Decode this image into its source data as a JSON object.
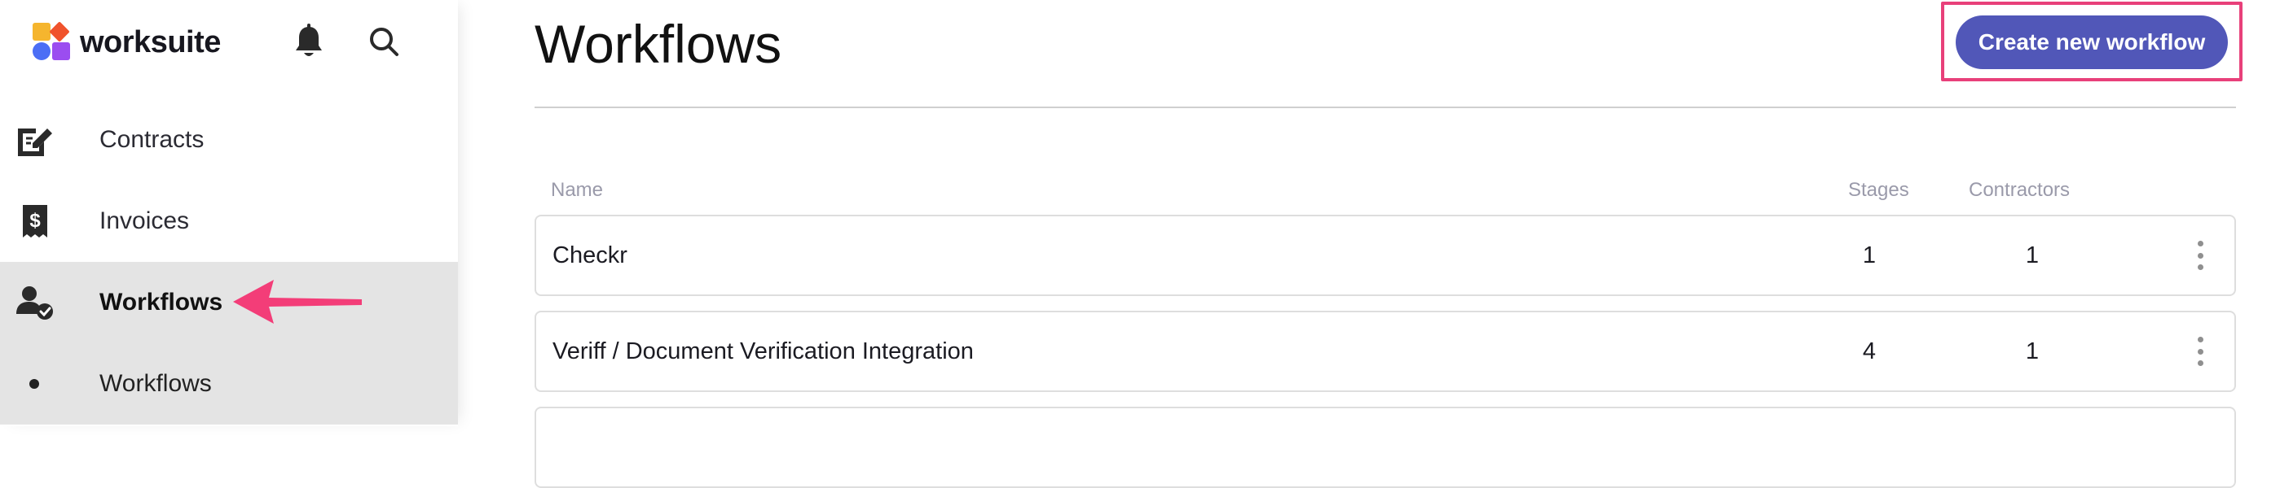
{
  "app": {
    "name": "worksuite"
  },
  "header": {
    "notifications_icon": "bell-icon",
    "search_icon": "search-icon"
  },
  "sidebar": {
    "items": [
      {
        "label": "Contracts",
        "icon": "contract-edit-icon",
        "active": false
      },
      {
        "label": "Invoices",
        "icon": "invoice-dollar-icon",
        "active": false
      },
      {
        "label": "Workflows",
        "icon": "user-check-icon",
        "active": true
      },
      {
        "label": "Workflows",
        "icon": "bullet-dot",
        "active": false,
        "sub": true
      }
    ]
  },
  "main": {
    "title": "Workflows",
    "create_button": "Create new workflow",
    "columns": {
      "name": "Name",
      "stages": "Stages",
      "contractors": "Contractors"
    },
    "rows": [
      {
        "name": "Checkr",
        "stages": "1",
        "contractors": "1"
      },
      {
        "name": "Veriff / Document Verification Integration",
        "stages": "4",
        "contractors": "1"
      }
    ]
  },
  "colors": {
    "accent": "#5157b8",
    "highlight": "#e8407a",
    "active_nav_bg": "#e4e4e4"
  }
}
